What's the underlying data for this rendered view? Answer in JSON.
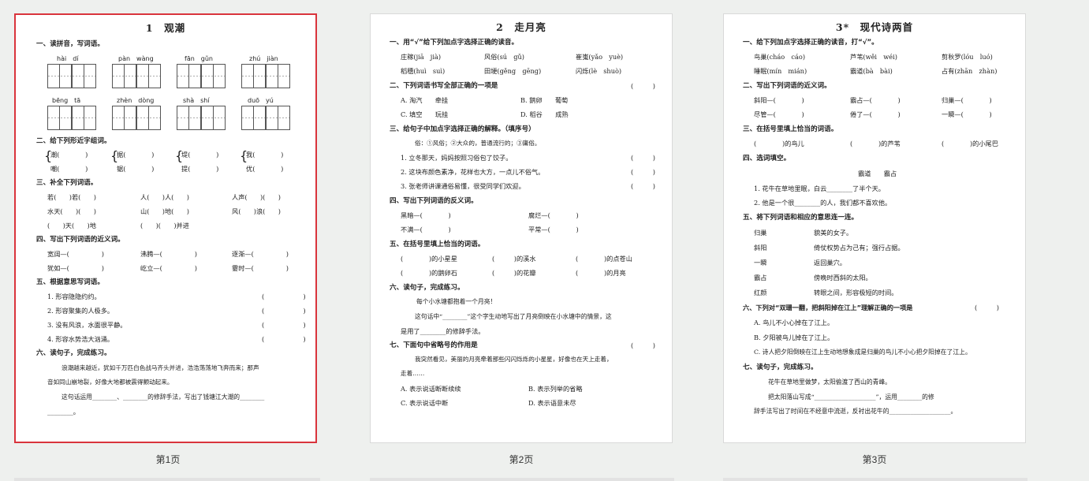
{
  "pages": [
    {
      "caption": "第1页",
      "title": "1　观潮",
      "sections": [
        "一、读拼音，写词语。",
        "二、给下列形近字组词。",
        "三、补全下列词语。",
        "四、写出下列词语的近义词。",
        "五、根据意思写词语。",
        "六、读句子，完成练习。"
      ],
      "pinyin_row1": [
        "hài　dí",
        "pàn　wàng",
        "fān　gǔn",
        "zhú　jiàn"
      ],
      "pinyin_row2": [
        "bēng　tā",
        "zhèn　dòng",
        "shà　shí",
        "duō　yú"
      ],
      "q2": [
        "潮(　　　　)",
        "嘲(　　　　)",
        "据(　　　　)",
        "锯(　　　　)",
        "堤(　　　　)",
        "提(　　　　)",
        "我(　　　　)",
        "优(　　　　)"
      ],
      "q3": [
        "若(　　)若(　　)",
        "人(　　)人(　　)",
        "人声(　　)(　　)",
        "水天(　　)(　　)",
        "山(　　)地(　　)",
        "风(　　)浪(　　)",
        "(　　)天(　　)地",
        "(　　)(　　)并进"
      ],
      "q4": [
        "宽阔—(　　　　　)",
        "沸腾—(　　　　　)",
        "逐渐—(　　　　　)",
        "犹如—(　　　　　)",
        "屹立—(　　　　　)",
        "霎时—(　　　　　)"
      ],
      "q5": [
        "1. 形容隐隐约约。",
        "2. 形容聚集的人极多。",
        "3. 没有风浪，水面很平静。",
        "4. 形容水势浩大汹涌。"
      ],
      "q5_blank": "(　　　　　　)",
      "q6_text": "浪潮越来越近，犹如千万匹白色战马齐头并进，浩浩荡荡地飞奔而来；那声",
      "q6_text2": "音如同山崩地裂，好像大地都被震得颤动起来。",
      "q6_q": "这句话运用________、________的修辞手法，写出了钱塘江大潮的________",
      "q6_end": "________。"
    },
    {
      "caption": "第2页",
      "title": "2　走月亮",
      "sections": [
        "一、用“√”给下列加点字选择正确的读音。",
        "二、下列词语书写全部正确的一项是",
        "三、给句子中加点字选择正确的解释。（填序号）",
        "四、写出下列词语的反义词。",
        "五、在括号里填上恰当的词语。",
        "六、读句子，完成练习。",
        "七、下面句中省略号的作用是"
      ],
      "q1": [
        "庄稼(jiā　jià)",
        "风俗(sú　gǔ)",
        "崔嵬(yǎo　yuè)",
        "稻穗(huì　suì)",
        "田埂(gěng　gēng)",
        "闪烁(lè　shuò)"
      ],
      "q2": [
        "A. 淘汽　　牵挂",
        "B. 鹅卵　　葡萄",
        "C. 填空　　玩挂",
        "D. 稻谷　　成熟"
      ],
      "q3_note": "俗：①风俗；②大众的，普通流行的；③庸俗。",
      "q3": [
        "1. 立冬那天，妈妈按照习俗包了饺子。",
        "2. 这块布颜色素净，花样也大方，一点儿不俗气。",
        "3. 张老师讲课通俗易懂，很受同学们欢迎。"
      ],
      "paren": "(　　　)",
      "q4": [
        "黑暗—(　　　　)",
        "腐烂—(　　　　)",
        "不满—(　　　　)",
        "平常—(　　　　)"
      ],
      "q5": [
        "(　　　　)的小星星",
        "(　　　)的溪水",
        "(　　　　)的点苍山",
        "(　　　　)的鹅卵石",
        "(　　　)的花瓣",
        "(　　　　)的月亮"
      ],
      "q6_quote": "每个小水塘都抱着一个月亮！",
      "q6_q1": "这句话中“________”这个字生动地写出了月亮倒映在小水塘中的情景，这",
      "q6_q2": "是用了________的修辞手法。",
      "q7_text": "我突然看见，美丽的月亮牵着那些闪闪烁烁的小星星，好像也在天上走着，",
      "q7_text2": "走着……",
      "q7_opts": [
        "A. 表示说话断断续续",
        "B. 表示列举的省略",
        "C. 表示说话中断",
        "D. 表示语意未尽"
      ]
    },
    {
      "caption": "第3页",
      "title": "3*　现代诗两首",
      "sections": [
        "一、给下列加点字选择正确的读音，打“√”。",
        "二、写出下列词语的近义词。",
        "三、在括号里填上恰当的词语。",
        "四、选词填空。",
        "五、将下列词语和相应的意思连一连。",
        "六、下列对“双珊一翻，把斜阳掉在江上”理解正确的一项是",
        "七、读句子，完成练习。"
      ],
      "q1": [
        "鸟巢(cháo　cáo)",
        "芦苇(wěi　wéi)",
        "剪秋罗(lóu　luó)",
        "睡眠(mín　mián)",
        "霸道(bà　bài)",
        "占有(zhān　zhàn)"
      ],
      "q2": [
        "斜阳—(　　　　)",
        "霸占—(　　　　)",
        "归巢—(　　　　)",
        "尽管—(　　　　)",
        "倦了—(　　　　)",
        "一瞬—(　　　　)"
      ],
      "q3": [
        "(　　　　)的鸟儿",
        "(　　　　)的芦苇",
        "(　　　　)的小尾巴"
      ],
      "q4_words": "霸道　　霸占",
      "q4": [
        "1. 花牛在草地里眠，白云________了半个天。",
        "2. 他是一个很________的人，我们都不喜欢他。"
      ],
      "q5_left": [
        "归巢",
        "斜阳",
        "一瞬",
        "霸占",
        "红颜"
      ],
      "q5_right": [
        "貌美的女子。",
        "倚仗权势占为己有；强行占据。",
        "返回巢穴。",
        "傍晚时西斜的太阳。",
        "转眼之间，形容极短的时间。"
      ],
      "q6_paren": "(　　　)",
      "q6_opts": [
        "A. 鸟儿不小心掉在了江上。",
        "B. 夕阳被鸟儿掉在了江上。",
        "C. 诗人把夕阳倒映在江上生动地想象成是归巢的鸟儿不小心把夕阳掉在了江上。"
      ],
      "q7_text": "花牛在草地里做梦，太阳偷渡了西山的青峰。",
      "q7_q1": "把太阳落山写成“____________________”，运用________的修",
      "q7_q2": "辞手法写出了时间在不经意中流逝，反衬出花牛的____________________。"
    }
  ]
}
